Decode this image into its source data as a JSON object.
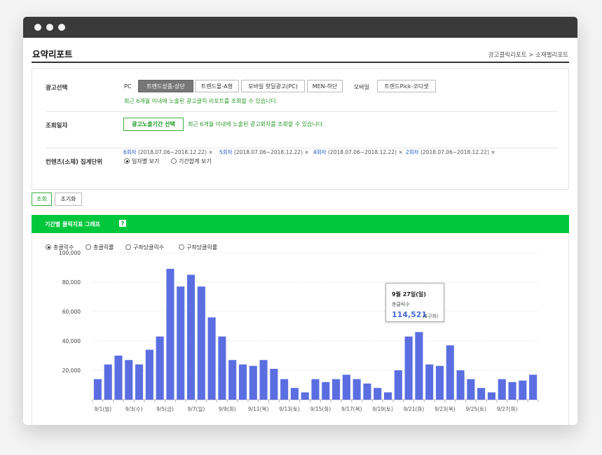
{
  "page": {
    "title": "요약리포트",
    "breadcrumb": "광고클릭리포트 > 소재별리포트"
  },
  "filters": {
    "ad_select": {
      "label": "광고선택",
      "pc_label": "PC",
      "pc_options": [
        "트렌드상품-상단",
        "트렌드몰-A형",
        "모바일 핫딜광고(PC)",
        "MEN-하단"
      ],
      "pc_selected": 0,
      "mobile_label": "모바일",
      "mobile_options": [
        "트렌드Pick-코디셋"
      ],
      "note": "최근 6개월 이내에 노출된 광고클릭 리포트를 조회할 수 있습니다."
    },
    "date_select": {
      "label": "조회일자",
      "button": "광고노출기간 선택",
      "note": "최근 6개월 이내에 노출된 광고회차를 조회할 수 있습니다.",
      "rounds": [
        {
          "name": "6회차",
          "period": "(2018.07.06~2018.12.22)"
        },
        {
          "name": "5회차",
          "period": "(2018.07.06~2018.12.22)"
        },
        {
          "name": "4회차",
          "period": "(2018.07.06~2018.12.22)"
        },
        {
          "name": "2회차",
          "period": "(2018.07.06~2018.12.22)"
        }
      ],
      "remove_glyph": "×"
    },
    "unit_select": {
      "label": "컨텐츠(소재) 집계단위",
      "options": [
        "일자별 보기",
        "기간합계 보기"
      ],
      "selected": 0
    }
  },
  "actions": {
    "search": "조회",
    "reset": "초기화"
  },
  "graph": {
    "title": "기간별 클릭지표 그래프",
    "help": "?",
    "metrics": [
      "총클릭수",
      "총클릭률",
      "구좌당클릭수",
      "구좌당클릭률"
    ],
    "selected_metric": 0,
    "tooltip": {
      "date": "9월 27일(일)",
      "label": "총클릭수",
      "value": "114,521",
      "unit": "(5구좌)"
    }
  },
  "colors": {
    "accent_green": "#00c73c",
    "bar_blue": "#5b6ee1",
    "titlebar": "#3a3a3a"
  },
  "chart_data": {
    "type": "bar",
    "ylim": [
      0,
      100000
    ],
    "yticks": [
      "20,000",
      "40,000",
      "60,000",
      "80,000",
      "100,000"
    ],
    "x_tick_labels": [
      "9/1(월)",
      "9/3(수)",
      "9/5(금)",
      "9/7(일)",
      "9/9(화)",
      "9/11(목)",
      "9/13(토)",
      "9/15(화)",
      "9/17(목)",
      "9/19(토)",
      "9/21(화)",
      "9/23(목)",
      "9/25(토)",
      "9/27(화)"
    ],
    "values": [
      14000,
      24000,
      30000,
      27000,
      24000,
      34000,
      43000,
      89000,
      77000,
      85000,
      77000,
      56000,
      43000,
      27000,
      24000,
      23000,
      27000,
      21000,
      14000,
      8000,
      5000,
      14000,
      12000,
      14000,
      17000,
      14000,
      11000,
      8000,
      5000,
      20000,
      43000,
      46000,
      24000,
      23000,
      37000,
      20000,
      14000,
      8000,
      5000,
      14000,
      12000,
      13000,
      17000
    ]
  }
}
